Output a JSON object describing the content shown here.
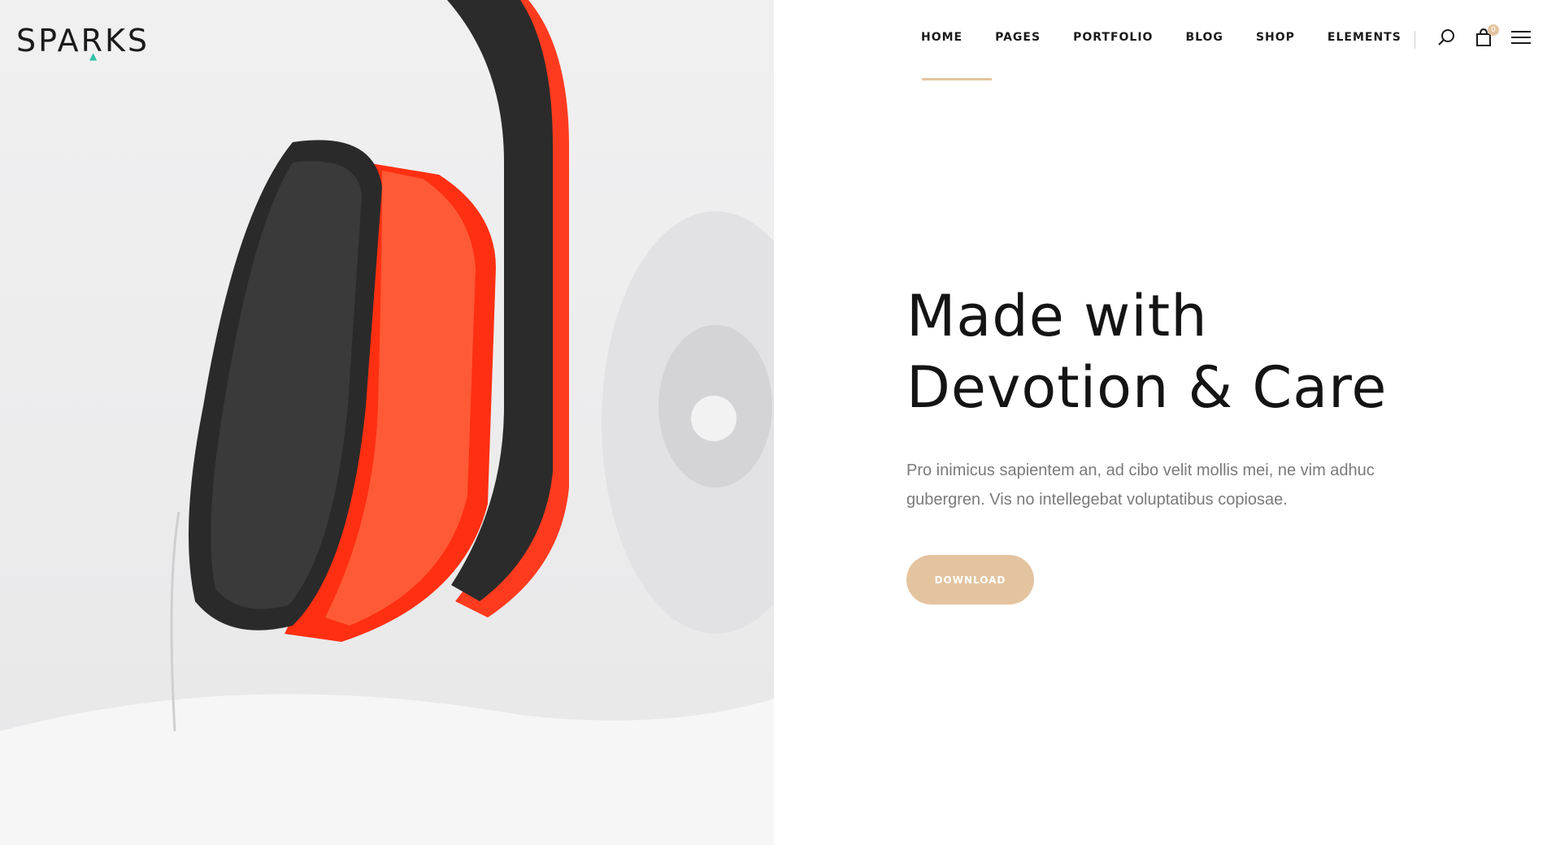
{
  "brand": {
    "logo_text": "SPARKS",
    "accent_color": "#e4c49f",
    "logo_accent_color": "#2ec4a6"
  },
  "nav": {
    "items": [
      {
        "label": "HOME",
        "active": true
      },
      {
        "label": "PAGES"
      },
      {
        "label": "PORTFOLIO"
      },
      {
        "label": "BLOG"
      },
      {
        "label": "SHOP"
      },
      {
        "label": "ELEMENTS"
      }
    ],
    "icons": [
      "search-icon",
      "cart-icon",
      "menu-icon"
    ],
    "cart_count": "0"
  },
  "hero": {
    "title_line1": "Made with",
    "title_line2": "Devotion & Care",
    "text": "Pro inimicus sapientem an, ad cibo velit mollis mei, ne vim adhuc gubergren. Vis no intellegebat voluptatibus copiosae.",
    "button_label": "DOWNLOAD",
    "image_accent_color": "#ff3b1f"
  }
}
